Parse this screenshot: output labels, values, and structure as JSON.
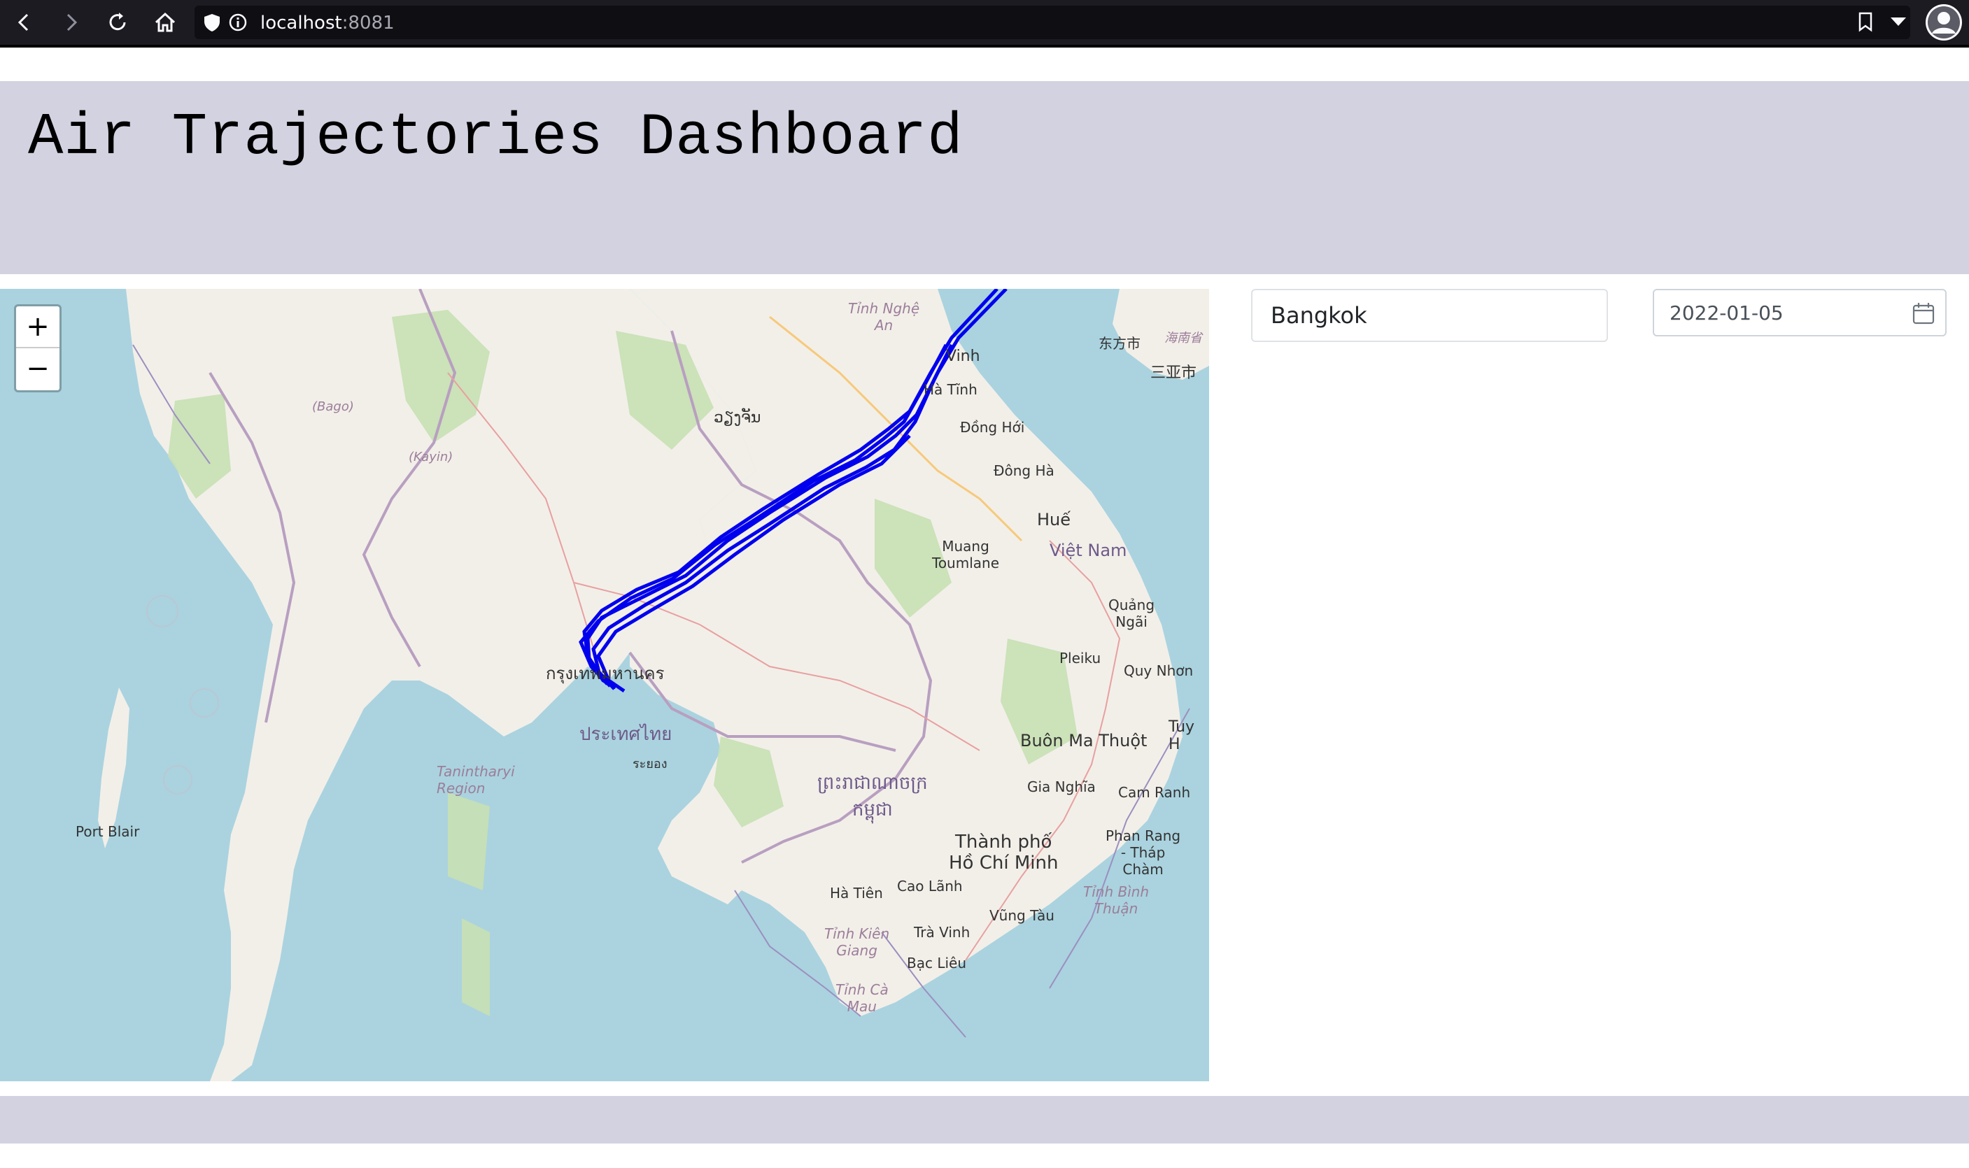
{
  "browser": {
    "url_host": "localhost",
    "url_port": ":8081",
    "icons": [
      "back-icon",
      "forward-icon",
      "reload-icon",
      "home-icon",
      "shield-icon",
      "info-icon",
      "bookmark-icon",
      "dropdown-icon",
      "account-icon"
    ]
  },
  "header": {
    "title": "Air Trajectories Dashboard"
  },
  "map": {
    "zoom_in_label": "+",
    "zoom_out_label": "−",
    "trajectory_color": "#0000ee",
    "labels": {
      "port_blair": "Port Blair",
      "tanintharyi": "Tanintharyi\nRegion",
      "bago": "(Bago)",
      "kayin": "(Kayin)",
      "thai_bkk": "กรุงเทพมหานคร",
      "gulf": "ประเทศไทย",
      "rayong": "ระยอง",
      "vientiane": "ວຽງຈັນ",
      "vinh": "Vinh",
      "ha_tinh": "Hà Tĩnh",
      "dong_hoi": "Đồng Hới",
      "dong_ha": "Đông Hà",
      "hue": "Huế",
      "viet_nam": "Việt Nam",
      "muang_toumlane": "Muang\nToumlane",
      "quang_ngai": "Quảng\nNgãi",
      "pleiku": "Pleiku",
      "quy_nhon": "Quy Nhơn",
      "tuy_hoa": "Tuy H",
      "buon_ma_thuot": "Buôn Ma Thuột",
      "gia_nghia": "Gia Nghĩa",
      "cam_ranh": "Cam Ranh",
      "phan_rang": "Phan Rang\n- Tháp\nChàm",
      "thanh_pho": "Thành phố\nHồ Chí Minh",
      "cao_lanh": "Cao Lãnh",
      "vung_tau": "Vũng Tàu",
      "tra_vinh": "Trà Vinh",
      "bac_lieu": "Bạc Liêu",
      "ha_tien": "Hà Tiên",
      "tinh_kien_giang": "Tỉnh Kiên\nGiang",
      "tinh_ca_mau": "Tỉnh Cà\nMau",
      "tinh_binh_thuan": "Tỉnh Bình\nThuận",
      "tinh_nghe_an": "Tỉnh Nghệ\nAn",
      "cambodia": "ព្រះរាជាណាចក្រ\nកម្ពុជា",
      "dongfang": "东方市",
      "sanya": "三亚市",
      "hainan": "海南省"
    }
  },
  "controls": {
    "city_value": "Bangkok",
    "date_value": "2022-01-05"
  }
}
